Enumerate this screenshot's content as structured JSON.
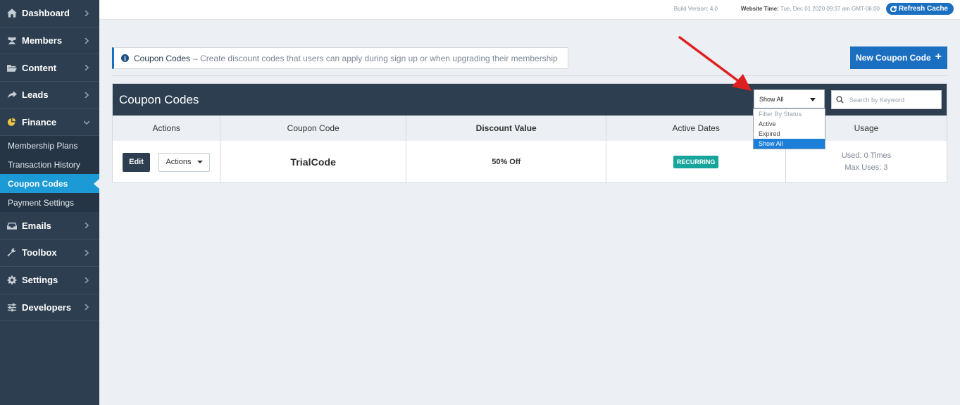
{
  "sidebar": {
    "items": [
      {
        "label": "Dashboard",
        "icon": "home-icon"
      },
      {
        "label": "Members",
        "icon": "users-icon"
      },
      {
        "label": "Content",
        "icon": "folder-icon"
      },
      {
        "label": "Leads",
        "icon": "share-icon"
      },
      {
        "label": "Finance",
        "icon": "pie-chart-icon",
        "expanded": true
      },
      {
        "label": "Emails",
        "icon": "inbox-icon"
      },
      {
        "label": "Toolbox",
        "icon": "wrench-icon"
      },
      {
        "label": "Settings",
        "icon": "gear-icon"
      },
      {
        "label": "Developers",
        "icon": "sliders-icon"
      }
    ],
    "finance_sub": [
      {
        "label": "Membership Plans",
        "active": false
      },
      {
        "label": "Transaction History",
        "active": false
      },
      {
        "label": "Coupon Codes",
        "active": true
      },
      {
        "label": "Payment Settings",
        "active": false
      }
    ]
  },
  "topbar": {
    "build_version": "Build Version: 4.0",
    "website_time_label": "Website Time:",
    "website_time_value": "Tue, Dec 01 2020 09:37 am GMT-06:00",
    "refresh_label": "Refresh Cache"
  },
  "info": {
    "title": "Coupon Codes",
    "description": "– Create discount codes that users can apply during sign up or when upgrading their membership"
  },
  "new_button_label": "New Coupon Code",
  "panel": {
    "title": "Coupon Codes",
    "filter": {
      "selected": "Show All",
      "options": [
        {
          "label": "Filter By Status",
          "disabled": true
        },
        {
          "label": "Active"
        },
        {
          "label": "Expired"
        },
        {
          "label": "Show All",
          "selected": true
        }
      ]
    },
    "search_placeholder": "Search by Keyword",
    "columns": [
      "Actions",
      "Coupon Code",
      "Discount Value",
      "Active Dates",
      "Usage"
    ],
    "rows": [
      {
        "edit_label": "Edit",
        "actions_label": "Actions",
        "code": "TrialCode",
        "discount": "50% Off",
        "active_dates": "RECURRING",
        "used": "Used: 0 Times",
        "max_uses": "Max Uses: 3"
      }
    ]
  },
  "colors": {
    "sidebar_bg": "#2c3e50",
    "accent_blue": "#1b6fc1",
    "active_sub": "#1b9ad6",
    "badge": "#16a59a",
    "arrow": "#e02020"
  }
}
